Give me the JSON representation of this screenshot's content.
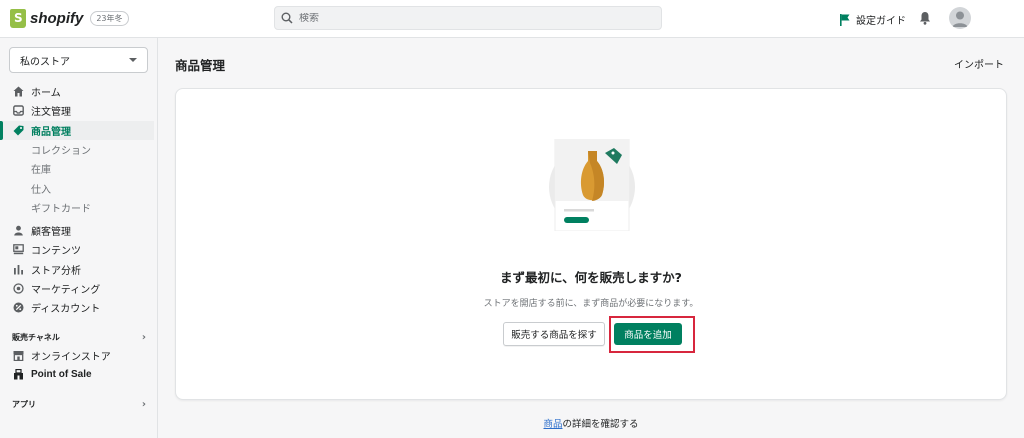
{
  "topbar": {
    "logo_text": "shopify",
    "logo_badge": "23年冬",
    "search_placeholder": "検索",
    "setup_guide": "設定ガイド"
  },
  "sidebar": {
    "store_name": "私のストア",
    "nav": [
      {
        "label": "ホーム",
        "icon": "home-icon"
      },
      {
        "label": "注文管理",
        "icon": "inbox-icon"
      },
      {
        "label": "商品管理",
        "icon": "tag-icon",
        "active": true
      }
    ],
    "products_sub": [
      "コレクション",
      "在庫",
      "仕入",
      "ギフトカード"
    ],
    "nav2": [
      {
        "label": "顧客管理",
        "icon": "person-icon"
      },
      {
        "label": "コンテンツ",
        "icon": "content-icon"
      },
      {
        "label": "ストア分析",
        "icon": "bar-chart-icon"
      },
      {
        "label": "マーケティング",
        "icon": "target-icon"
      },
      {
        "label": "ディスカウント",
        "icon": "discount-icon"
      }
    ],
    "sales_channels_label": "販売チャネル",
    "channels": [
      {
        "label": "オンラインストア",
        "icon": "store-icon"
      },
      {
        "label": "Point of Sale",
        "icon": "pos-icon"
      }
    ],
    "apps_label": "アプリ"
  },
  "main": {
    "page_title": "商品管理",
    "import_label": "インポート",
    "empty_heading": "まず最初に、何を販売しますか?",
    "empty_description": "ストアを開店する前に、まず商品が必要になります。",
    "find_products_button": "販売する商品を探す",
    "add_product_button": "商品を追加",
    "learn_more_link": "商品",
    "learn_more_suffix": "の詳細を確認する"
  },
  "colors": {
    "accent": "#008060",
    "highlight_box": "#d7263d",
    "link": "#2c6ecb"
  }
}
